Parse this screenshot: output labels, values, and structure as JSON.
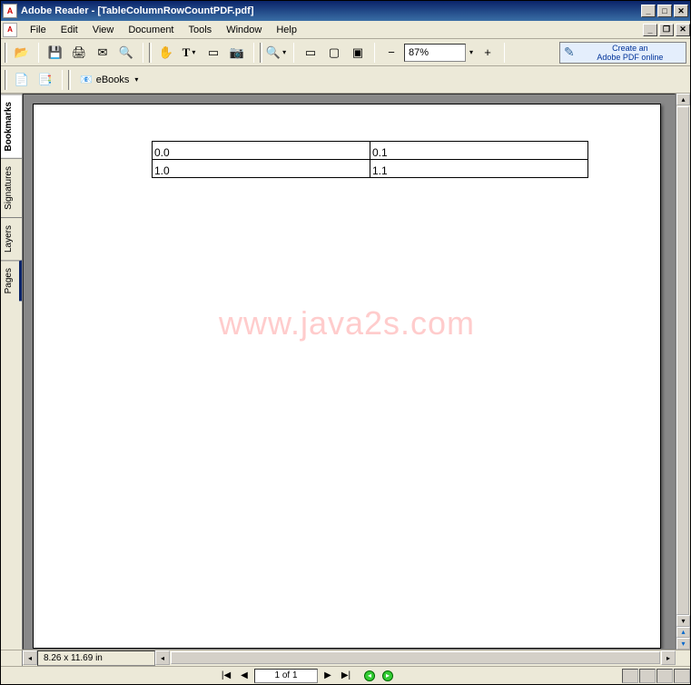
{
  "titlebar": {
    "app": "Adobe Reader",
    "doc": "[TableColumnRowCountPDF.pdf]"
  },
  "menus": {
    "file": "File",
    "edit": "Edit",
    "view": "View",
    "document": "Document",
    "tools": "Tools",
    "window": "Window",
    "help": "Help"
  },
  "toolbar": {
    "zoom": "87%",
    "create_line1": "Create an",
    "create_line2": "Adobe PDF online",
    "ebooks": "eBooks"
  },
  "sidebar": {
    "bookmarks": "Bookmarks",
    "signatures": "Signatures",
    "layers": "Layers",
    "pages": "Pages"
  },
  "page": {
    "table": {
      "r0c0": "0.0",
      "r0c1": "0.1",
      "r1c0": "1.0",
      "r1c1": "1.1"
    },
    "watermark": "www.java2s.com"
  },
  "status": {
    "dim": "8.26 x 11.69 in",
    "pagenum": "1 of 1"
  },
  "icons": {
    "open": "📂",
    "save": "💾",
    "print": "🖨",
    "mail": "✉",
    "find": "🔍",
    "hand": "✋",
    "textsel": "T",
    "select": "▭",
    "snapshot": "📷",
    "zoomin": "🔍",
    "fit": "▭",
    "actual": "▢",
    "fitwidth": "▣",
    "minus": "−",
    "plus": "+",
    "first": "|◀",
    "prev": "◀",
    "next": "▶",
    "last": "▶|",
    "up": "▲",
    "down": "▼"
  }
}
